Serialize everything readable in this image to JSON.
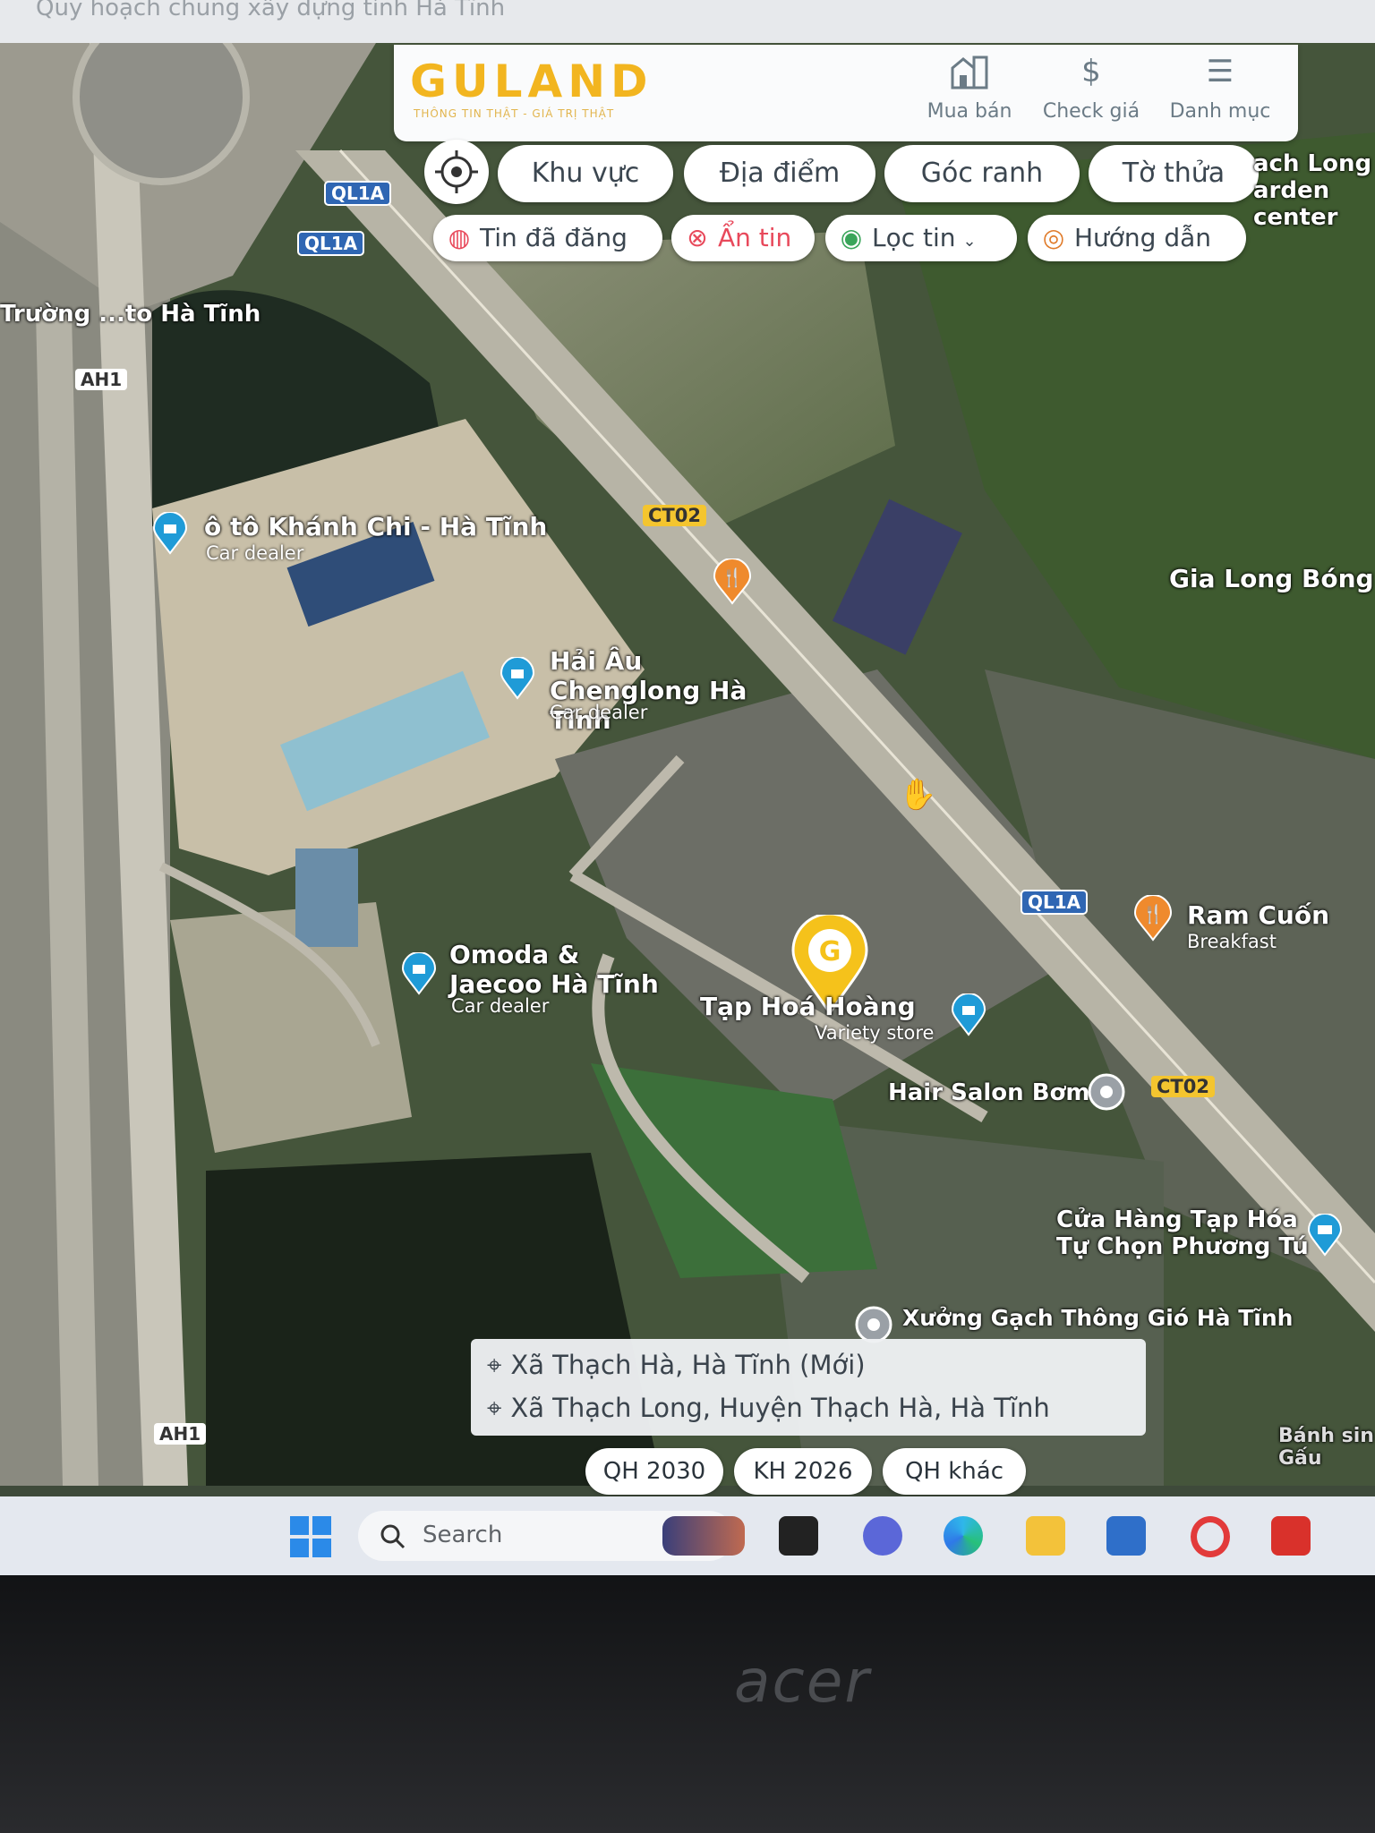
{
  "browser": {
    "partial_title": "Quy hoạch chung xây dựng tỉnh Hà Tĩnh"
  },
  "header": {
    "logo": "GULAND",
    "tagline": "THÔNG TIN THẬT - GIÁ TRỊ THẬT",
    "nav": [
      {
        "label": "Mua bán",
        "icon": "building-icon"
      },
      {
        "label": "Check giá",
        "icon": "dollar-icon"
      },
      {
        "label": "Danh mục",
        "icon": "menu-icon"
      }
    ]
  },
  "filters": {
    "row1": [
      "Khu vực",
      "Địa điểm",
      "Góc ranh",
      "Tờ thửa"
    ],
    "row2": [
      "Tin đã đăng",
      "Ẩn tin",
      "Lọc tin",
      "Hướng dẫn"
    ]
  },
  "map": {
    "roads": [
      "QL1A",
      "QL1A",
      "AH1",
      "CT02",
      "QL1A",
      "CT02",
      "AH1"
    ],
    "places": [
      {
        "name": "ô tô Khánh Chi - Hà Tĩnh",
        "type": "Car dealer"
      },
      {
        "name": "Hải Âu Chenglong Hà Tĩnh",
        "type": "Car dealer"
      },
      {
        "name": "Omoda & Jaecoo Hà Tĩnh",
        "type": "Car dealer"
      },
      {
        "name": "Tạp Hoá Hoàng",
        "type": "Variety store"
      },
      {
        "name": "Ram Cuốn",
        "type": "Breakfast"
      },
      {
        "name": "Hair Salon Bơm",
        "type": ""
      },
      {
        "name": "Cửa Hàng Tạp Hóa Tự Chọn Phương Tú",
        "type": ""
      },
      {
        "name": "Xưởng Gạch Thông Gió Hà Tĩnh",
        "type": ""
      },
      {
        "name": "Gia Long Bóng Đ",
        "type": ""
      },
      {
        "name": "Trường ...to Hà Tĩnh",
        "type": ""
      },
      {
        "name": "ach Long arden center",
        "type": ""
      },
      {
        "name": "Bánh sin Gấu",
        "type": ""
      }
    ]
  },
  "address": {
    "line1": "Xã Thạch Hà, Hà Tĩnh (Mới)",
    "line2": "Xã Thạch Long, Huyện Thạch Hà, Hà Tĩnh"
  },
  "plans": [
    "QH 2030",
    "KH 2026",
    "QH khác"
  ],
  "taskbar": {
    "search_placeholder": "Search"
  },
  "laptop_brand": "acer",
  "colors": {
    "brand": "#F2B51F",
    "pill_bg": "#FFFFFF",
    "accent_red": "#E8495B"
  }
}
